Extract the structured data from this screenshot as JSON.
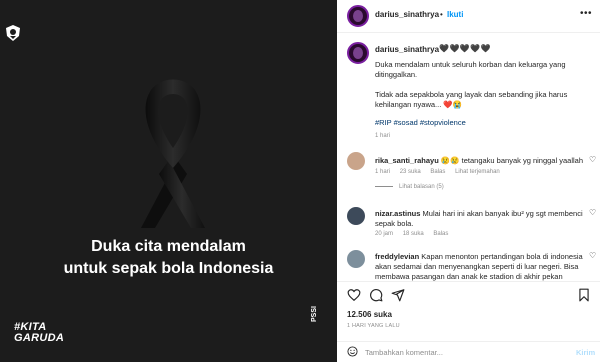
{
  "post_image": {
    "headline_line1": "Duka cita mendalam",
    "headline_line2": "untuk sepak bola Indonesia",
    "hashtag_line1": "#KITA",
    "hashtag_line2": "GARUDA",
    "watermark": "PSSI"
  },
  "header": {
    "username": "darius_sinathrya",
    "separator": "•",
    "follow_label": "Ikuti",
    "more_icon": "more-horizontal-icon"
  },
  "caption": {
    "username": "darius_sinathrya",
    "hearts": "🖤🖤🖤🖤🖤",
    "paragraph1": "Duka mendalam untuk seluruh korban dan keluarga yang ditinggalkan.",
    "paragraph2": "Tidak ada sepakbola yang layak dan sebanding jika harus kehilangan nyawa... ❤️😭",
    "tags": "#RIP #sosad #stopviolence",
    "time": "1 hari"
  },
  "comments": [
    {
      "username": "rika_santi_rahayu",
      "text": "😢😢 tetangaku banyak yg ninggal yaallah",
      "time": "1 hari",
      "likes": "23 suka",
      "reply": "Balas",
      "translate": "Lihat terjemahan",
      "view_replies": "Lihat balasan (5)"
    },
    {
      "username": "nizar.astinus",
      "text": "Mulai hari ini akan banyak ibu² yg sgt membenci sepak bola.",
      "time": "20 jam",
      "likes": "18 suka",
      "reply": "Balas"
    },
    {
      "username": "freddylevian",
      "text": "Kapan menonton pertandingan bola di indonesia akan sedamai dan menyenangkan seperti di luar negeri. Bisa membawa pasangan dan anak ke stadion di akhir pekan"
    }
  ],
  "actions": {
    "likes": "12.506 suka",
    "post_time": "1 HARI YANG LALU"
  },
  "composer": {
    "placeholder": "Tambahkan komentar...",
    "post_label": "Kirim"
  }
}
